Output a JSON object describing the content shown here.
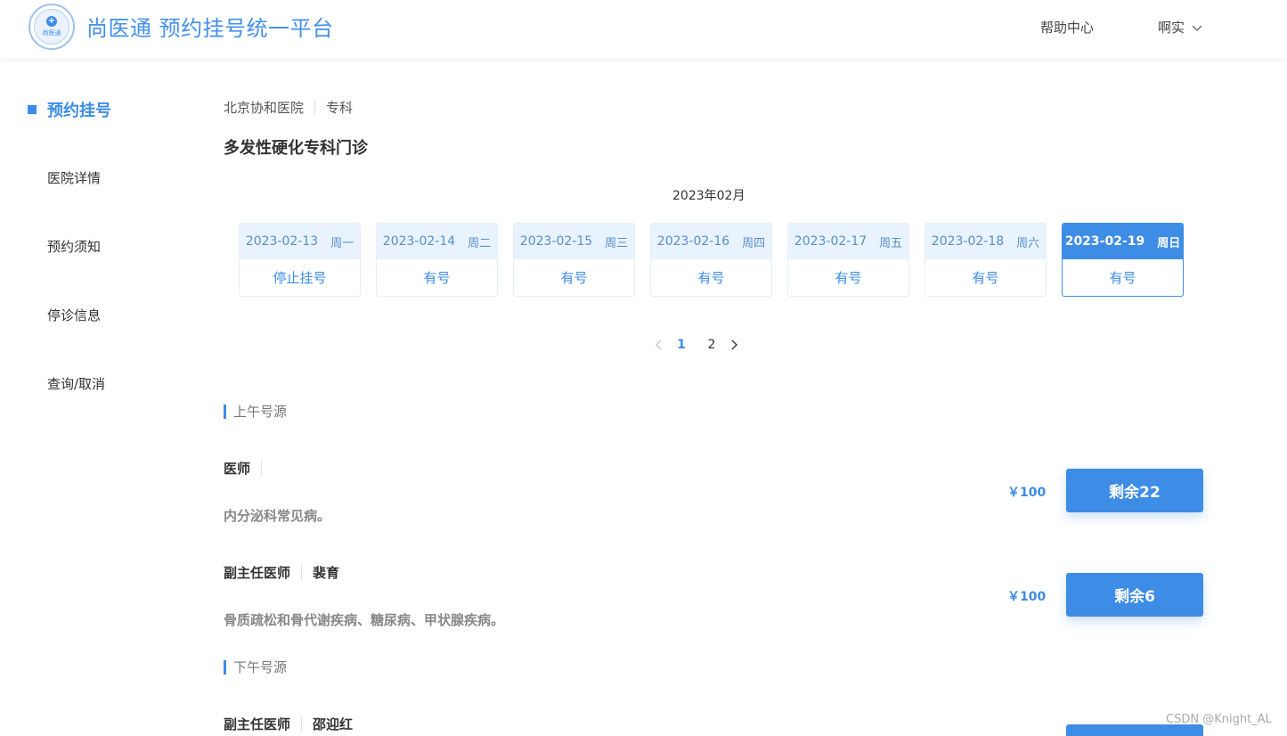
{
  "header": {
    "logo_text": "尚医通",
    "logo_cross": "+",
    "brand": "尚医通 预约挂号统一平台",
    "help": "帮助中心",
    "user": "啊实"
  },
  "sidebar": {
    "active": "预约挂号",
    "items": [
      {
        "label": "医院详情"
      },
      {
        "label": "预约须知"
      },
      {
        "label": "停诊信息"
      },
      {
        "label": "查询/取消"
      }
    ]
  },
  "breadcrumb": {
    "hospital": "北京协和医院",
    "category": "专科"
  },
  "department": "多发性硬化专科门诊",
  "month": "2023年02月",
  "days": [
    {
      "date": "2023-02-13",
      "weekday": "周一",
      "status": "停止挂号",
      "active": false
    },
    {
      "date": "2023-02-14",
      "weekday": "周二",
      "status": "有号",
      "active": false
    },
    {
      "date": "2023-02-15",
      "weekday": "周三",
      "status": "有号",
      "active": false
    },
    {
      "date": "2023-02-16",
      "weekday": "周四",
      "status": "有号",
      "active": false
    },
    {
      "date": "2023-02-17",
      "weekday": "周五",
      "status": "有号",
      "active": false
    },
    {
      "date": "2023-02-18",
      "weekday": "周六",
      "status": "有号",
      "active": false
    },
    {
      "date": "2023-02-19",
      "weekday": "周日",
      "status": "有号",
      "active": true
    }
  ],
  "pagination": {
    "pages": [
      "1",
      "2"
    ],
    "current": "1"
  },
  "morning": {
    "title": "上午号源",
    "doctors": [
      {
        "title": "医师",
        "name": "",
        "skill": "内分泌科常见病。",
        "price": "￥100",
        "remain": "剩余22"
      },
      {
        "title": "副主任医师",
        "name": "裴育",
        "skill": "骨质疏松和骨代谢疾病、糖尿病、甲状腺疾病。",
        "price": "￥100",
        "remain": "剩余6"
      }
    ]
  },
  "afternoon": {
    "title": "下午号源",
    "doctors": [
      {
        "title": "副主任医师",
        "name": "邵迎红"
      }
    ]
  },
  "watermark": "CSDN @Knight_AL",
  "colors": {
    "accent": "#3d8ce6",
    "tab_bg": "#e8f3ff"
  }
}
